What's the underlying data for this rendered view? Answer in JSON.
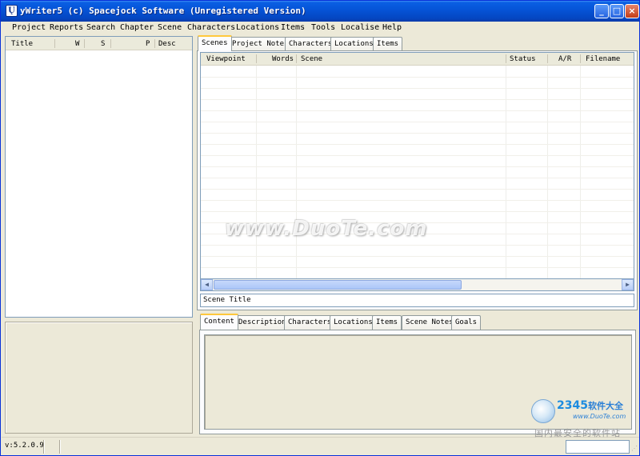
{
  "window": {
    "title": "yWriter5 (c) Spacejock Software (Unregistered Version)",
    "minimize": "_",
    "maximize": "□",
    "close": "×"
  },
  "menu": [
    "Project",
    "Reports",
    "Search",
    "Chapter",
    "Scene",
    "Characters",
    "Locations",
    "Items",
    "Tools",
    "Localise",
    "Help"
  ],
  "chapter_list": {
    "columns": [
      "Title",
      "W",
      "S",
      "P",
      "Desc"
    ]
  },
  "top_tabs": [
    "Scenes",
    "Project Notes",
    "Characters",
    "Locations",
    "Items"
  ],
  "scene_grid": {
    "columns": [
      "Viewpoint",
      "Words",
      "Scene",
      "Status",
      "A/R",
      "Filename"
    ]
  },
  "scene_title": "Scene Title",
  "bottom_tabs": [
    "Content",
    "Description",
    "Characters",
    "Locations",
    "Items",
    "Scene Notes",
    "Goals"
  ],
  "status": {
    "version": "v:5.2.0.9"
  },
  "watermark": {
    "text": "www.DuoTe.com"
  },
  "logo": {
    "brand": "2345",
    "brand_suffix": "软件大全",
    "url": "www.DuoTe.com",
    "tagline": "国内最安全的软件站"
  },
  "colors": {
    "titlebar": "#0553d6",
    "active_tab_accent": "#ffc83c",
    "window_bg": "#ece9d8"
  }
}
